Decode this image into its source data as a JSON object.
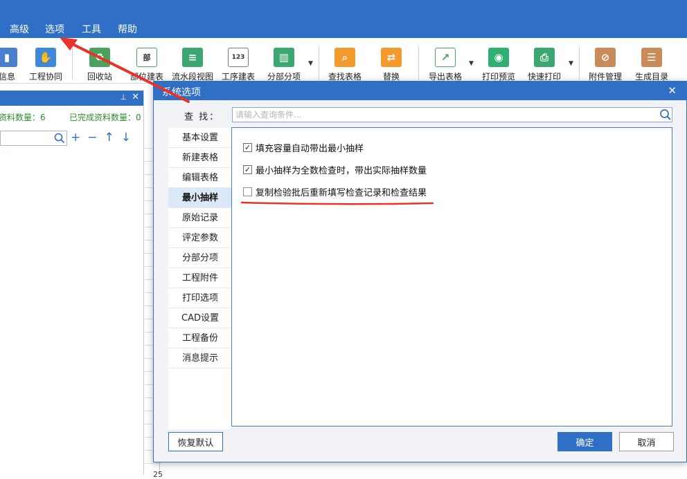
{
  "menu": {
    "items": [
      "高级",
      "选项",
      "工具",
      "帮助"
    ]
  },
  "ribbon": {
    "buttons": [
      {
        "label": "信息",
        "icon": "info-icon",
        "color": "#4a7fd0"
      },
      {
        "label": "工程协同",
        "icon": "handshake-icon",
        "color": "#3f87d9"
      },
      {
        "label": "回收站",
        "icon": "recycle-bin-icon",
        "color": "#4aa35c"
      },
      {
        "label": "部位建表",
        "icon": "table-part-icon",
        "color": "#4aa35c"
      },
      {
        "label": "流水段视图",
        "icon": "flow-view-icon",
        "color": "#3aa870"
      },
      {
        "label": "工序建表",
        "icon": "process-table-icon",
        "color": "#3aa870"
      },
      {
        "label": "分部分项",
        "icon": "bar-chart-icon",
        "color": "#3aa870"
      },
      {
        "label": "查找表格",
        "icon": "search-table-icon",
        "color": "#f39a2e"
      },
      {
        "label": "替换",
        "icon": "replace-icon",
        "color": "#f39a2e"
      },
      {
        "label": "导出表格",
        "icon": "export-table-icon",
        "color": "#4aa35c"
      },
      {
        "label": "打印预览",
        "icon": "eye-icon",
        "color": "#2fb070"
      },
      {
        "label": "快速打印",
        "icon": "printer-icon",
        "color": "#3aa870"
      },
      {
        "label": "附件管理",
        "icon": "paperclip-icon",
        "color": "#c98b5a"
      },
      {
        "label": "生成目录",
        "icon": "list-icon",
        "color": "#c98b5a"
      }
    ]
  },
  "left_panel": {
    "total_label": "资料数量：6",
    "done_label": "已完成资料数量：0"
  },
  "sheet": {
    "row_number": "25"
  },
  "dialog": {
    "title": "系统选项",
    "search_label": "查 找：",
    "search_placeholder": "请输入查询条件...",
    "nav": [
      "基本设置",
      "新建表格",
      "编辑表格",
      "最小抽样",
      "原始记录",
      "评定参数",
      "分部分项",
      "工程附件",
      "打印选项",
      "CAD设置",
      "工程备份",
      "消息提示"
    ],
    "active_nav": "最小抽样",
    "options": [
      {
        "label": "填充容量自动带出最小抽样",
        "checked": true
      },
      {
        "label": "最小抽样为全数检查时，带出实际抽样数量",
        "checked": true
      },
      {
        "label": "复制检验批后重新填写检查记录和检查结果",
        "checked": false
      }
    ],
    "buttons": {
      "restore": "恢复默认",
      "ok": "确定",
      "cancel": "取消"
    }
  },
  "colors": {
    "accent": "#2f6fc6",
    "annotation": "#e8322a"
  }
}
